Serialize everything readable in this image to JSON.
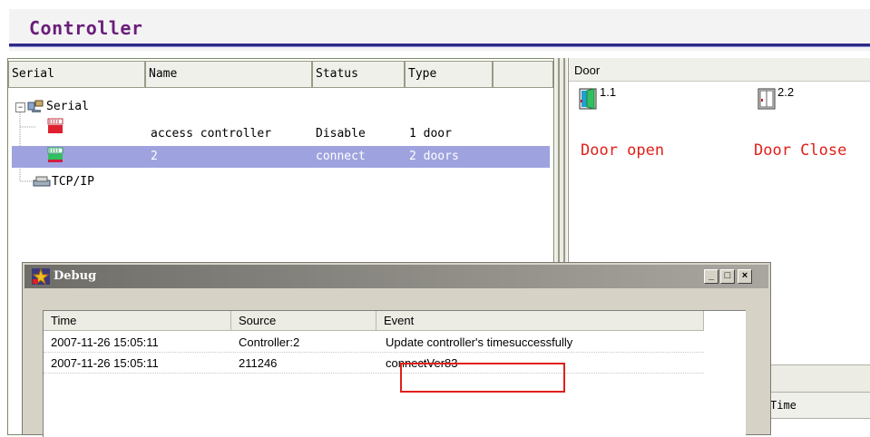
{
  "header": {
    "title": "Controller"
  },
  "tree": {
    "columns": [
      "Serial",
      "Name",
      "Status",
      "Type"
    ],
    "root_serial": "Serial",
    "rows": [
      {
        "name": "access controller",
        "status": "Disable",
        "type": "1 door"
      },
      {
        "name": "2",
        "status": "connect",
        "type": "2 doors"
      }
    ],
    "root_tcp": "TCP/IP"
  },
  "door_panel": {
    "header": "Door",
    "doors": [
      {
        "id": "1.1",
        "state": "Door open"
      },
      {
        "id": "2.2",
        "state": "Door Close"
      }
    ],
    "lower_col": "Time"
  },
  "debug": {
    "title": "Debug",
    "columns": [
      "Time",
      "Source",
      "Event"
    ],
    "rows": [
      {
        "time": "2007-11-26 15:05:11",
        "source": "Controller:2",
        "event": "Update controller's timesuccessfully"
      },
      {
        "time": "2007-11-26 15:05:11",
        "source": "211246",
        "event": "connectVer83"
      }
    ],
    "buttons": {
      "min": "_",
      "max": "□",
      "close": "×"
    }
  },
  "colors": {
    "selection": "#9ea3df",
    "header_title": "#6a1d7a",
    "accent_rule": "#2c2a86",
    "door_state": "#e0201a",
    "highlight": "#e0201a"
  }
}
